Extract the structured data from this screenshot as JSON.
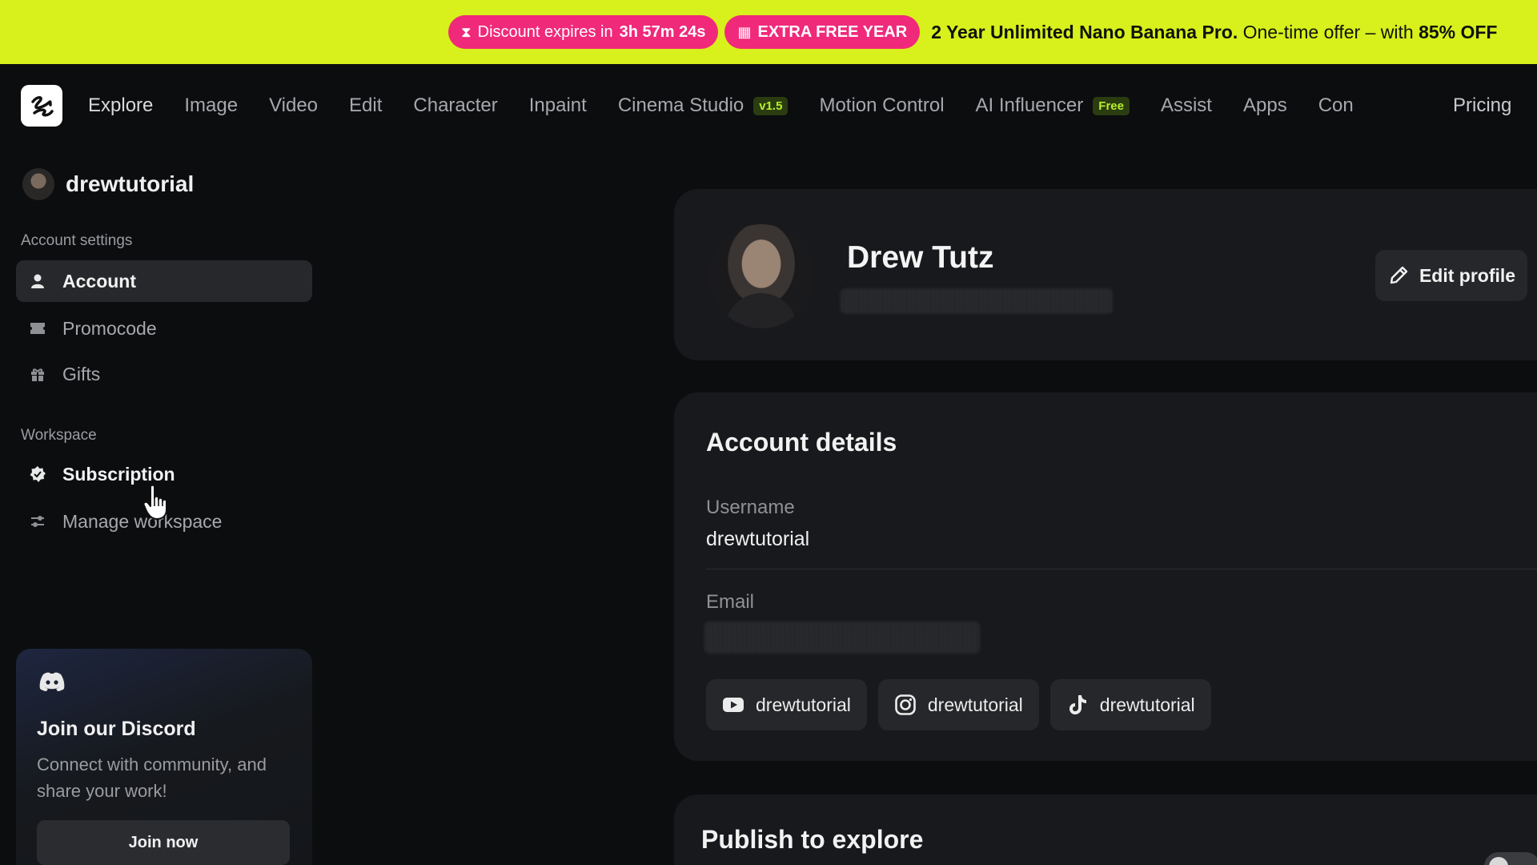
{
  "promo": {
    "timer_prefix": "Discount expires in",
    "timer_value": "3h 57m 24s",
    "extra_label": "EXTRA FREE YEAR",
    "offer_bold": "2 Year Unlimited Nano Banana Pro.",
    "offer_text": " One-time offer – with ",
    "offer_discount": "85% OFF"
  },
  "nav": {
    "items": [
      {
        "label": "Explore"
      },
      {
        "label": "Image"
      },
      {
        "label": "Video"
      },
      {
        "label": "Edit"
      },
      {
        "label": "Character"
      },
      {
        "label": "Inpaint"
      },
      {
        "label": "Cinema Studio",
        "badge": "v1.5"
      },
      {
        "label": "Motion Control"
      },
      {
        "label": "AI Influencer",
        "badge": "Free"
      },
      {
        "label": "Assist"
      },
      {
        "label": "Apps"
      },
      {
        "label": "Con"
      }
    ],
    "pricing": "Pricing"
  },
  "sidebar": {
    "username": "drewtutorial",
    "account_settings_label": "Account settings",
    "workspace_label": "Workspace",
    "items": [
      {
        "label": "Account",
        "icon": "user-icon"
      },
      {
        "label": "Promocode",
        "icon": "ticket-icon"
      },
      {
        "label": "Gifts",
        "icon": "gift-icon"
      },
      {
        "label": "Subscription",
        "icon": "badge-icon"
      },
      {
        "label": "Manage workspace",
        "icon": "sliders-icon"
      }
    ],
    "discord": {
      "title": "Join our Discord",
      "description": "Connect with community, and share your work!",
      "button": "Join now"
    }
  },
  "profile": {
    "name": "Drew Tutz",
    "edit_label": "Edit profile"
  },
  "account_details": {
    "title": "Account details",
    "username_label": "Username",
    "username_value": "drewtutorial",
    "email_label": "Email",
    "socials": [
      {
        "platform": "youtube-icon",
        "handle": "drewtutorial"
      },
      {
        "platform": "instagram-icon",
        "handle": "drewtutorial"
      },
      {
        "platform": "tiktok-icon",
        "handle": "drewtutorial"
      }
    ]
  },
  "publish": {
    "title": "Publish to explore"
  },
  "colors": {
    "banner": "#d8f01c",
    "pill": "#f0297a",
    "background": "#0b0d0f",
    "card": "#17191c"
  }
}
